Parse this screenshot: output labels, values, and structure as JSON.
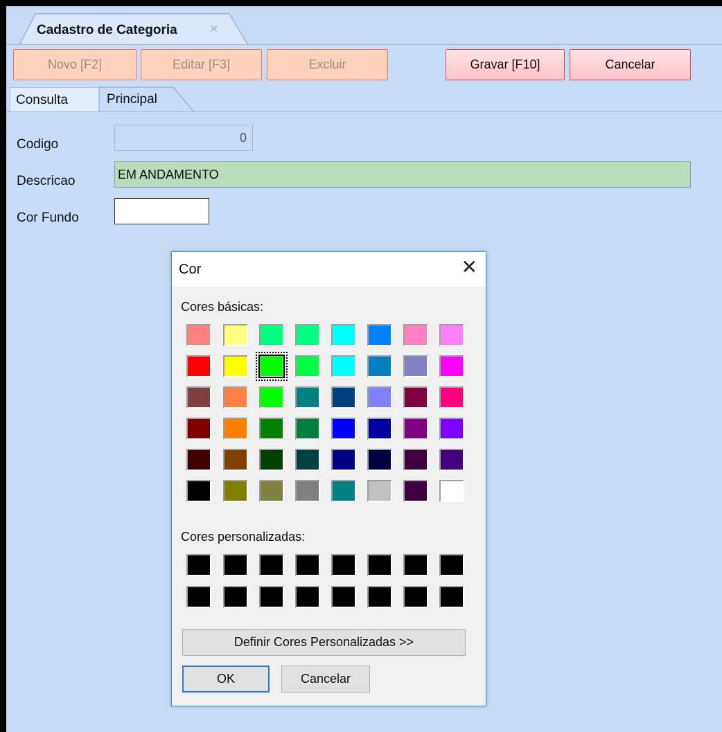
{
  "window": {
    "tab_title": "Cadastro de Categoria",
    "tab_close_icon": "×"
  },
  "toolbar": {
    "novo": "Novo [F2]",
    "editar": "Editar [F3]",
    "excluir": "Excluir",
    "gravar": "Gravar [F10]",
    "cancelar": "Cancelar"
  },
  "subtabs": {
    "consulta": "Consulta",
    "principal": "Principal"
  },
  "form": {
    "codigo_label": "Codigo",
    "codigo_value": "0",
    "descricao_label": "Descricao",
    "descricao_value": "EM ANDAMENTO",
    "cor_fundo_label": "Cor Fundo",
    "cor_fundo_value": "#ffffff"
  },
  "dialog": {
    "title": "Cor",
    "close_icon": "✕",
    "basic_label": "Cores básicas:",
    "custom_label": "Cores personalizadas:",
    "define_button": "Definir Cores Personalizadas >>",
    "ok_button": "OK",
    "cancel_button": "Cancelar",
    "selected_basic": {
      "row": 1,
      "col": 2
    },
    "basic_colors": [
      [
        "#ff8080",
        "#ffff80",
        "#00ff80",
        "#00ff80",
        "#00ffff",
        "#0080ff",
        "#ff80c0",
        "#ff80ff"
      ],
      [
        "#ff0000",
        "#ffff00",
        "#00ff00",
        "#00ff40",
        "#00ffff",
        "#0080c0",
        "#8080c0",
        "#ff00ff"
      ],
      [
        "#804040",
        "#ff8040",
        "#00ff00",
        "#008080",
        "#004080",
        "#8080ff",
        "#800040",
        "#ff0080"
      ],
      [
        "#800000",
        "#ff8000",
        "#008000",
        "#008040",
        "#0000ff",
        "#0000a0",
        "#800080",
        "#8000ff"
      ],
      [
        "#400000",
        "#804000",
        "#004000",
        "#004040",
        "#000080",
        "#000040",
        "#400040",
        "#400080"
      ],
      [
        "#000000",
        "#808000",
        "#808040",
        "#808080",
        "#008080",
        "#c0c0c0",
        "#400040",
        "#ffffff"
      ]
    ],
    "custom_colors": [
      [
        "#000000",
        "#000000",
        "#000000",
        "#000000",
        "#000000",
        "#000000",
        "#000000",
        "#000000"
      ],
      [
        "#000000",
        "#000000",
        "#000000",
        "#000000",
        "#000000",
        "#000000",
        "#000000",
        "#000000"
      ]
    ]
  }
}
